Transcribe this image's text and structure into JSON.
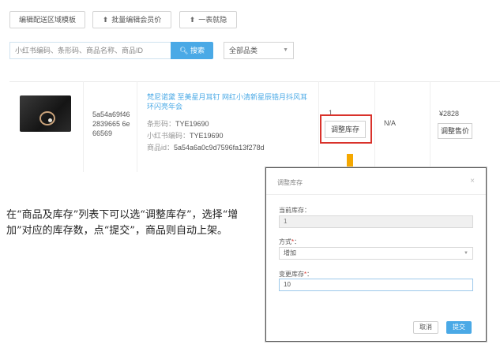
{
  "toolbar": {
    "edit_area_template": "编辑配送区域模板",
    "batch_edit_price": "批量编辑会员价",
    "one_click_list": "一表就隐"
  },
  "search": {
    "placeholder": "小红书编码、条形码、商品名称、商品ID",
    "button": "搜索",
    "category_select": "全部品类"
  },
  "product": {
    "sku_code": "5a54a69f462839665 6e66569",
    "title": "梵尼诺黛 至美星月耳钉 网红小清新星辰锆月抖风耳环闪亮年会",
    "barcode_label": "条形码：",
    "barcode_value": "TYE19690",
    "xhs_code_label": "小红书编码：",
    "xhs_code_value": "TYE19690",
    "product_id_label": "商品id：",
    "product_id_value": "5a54a6a0c9d7596fa13f278d",
    "stock": "1",
    "adjust_stock": "调整库存",
    "status": "N/A",
    "price": "¥2828",
    "adjust_price": "调整售价"
  },
  "instruction": "在“商品及库存”列表下可以选“调整库存”，选择“增加”对应的库存数，点“提交”，商品则自动上架。",
  "modal": {
    "title": "调整库存",
    "close": "×",
    "current_stock_label": "当前库存：",
    "current_stock_value": "1",
    "method_label": "方式",
    "method_value": "增加",
    "change_label": "变更库存",
    "required_mark": "*",
    "change_value": "10",
    "cancel": "取消",
    "submit": "提交"
  },
  "colors": {
    "accent": "#4aa9e6",
    "highlight_red": "#d9322b",
    "arrow_orange": "#f5a800"
  }
}
